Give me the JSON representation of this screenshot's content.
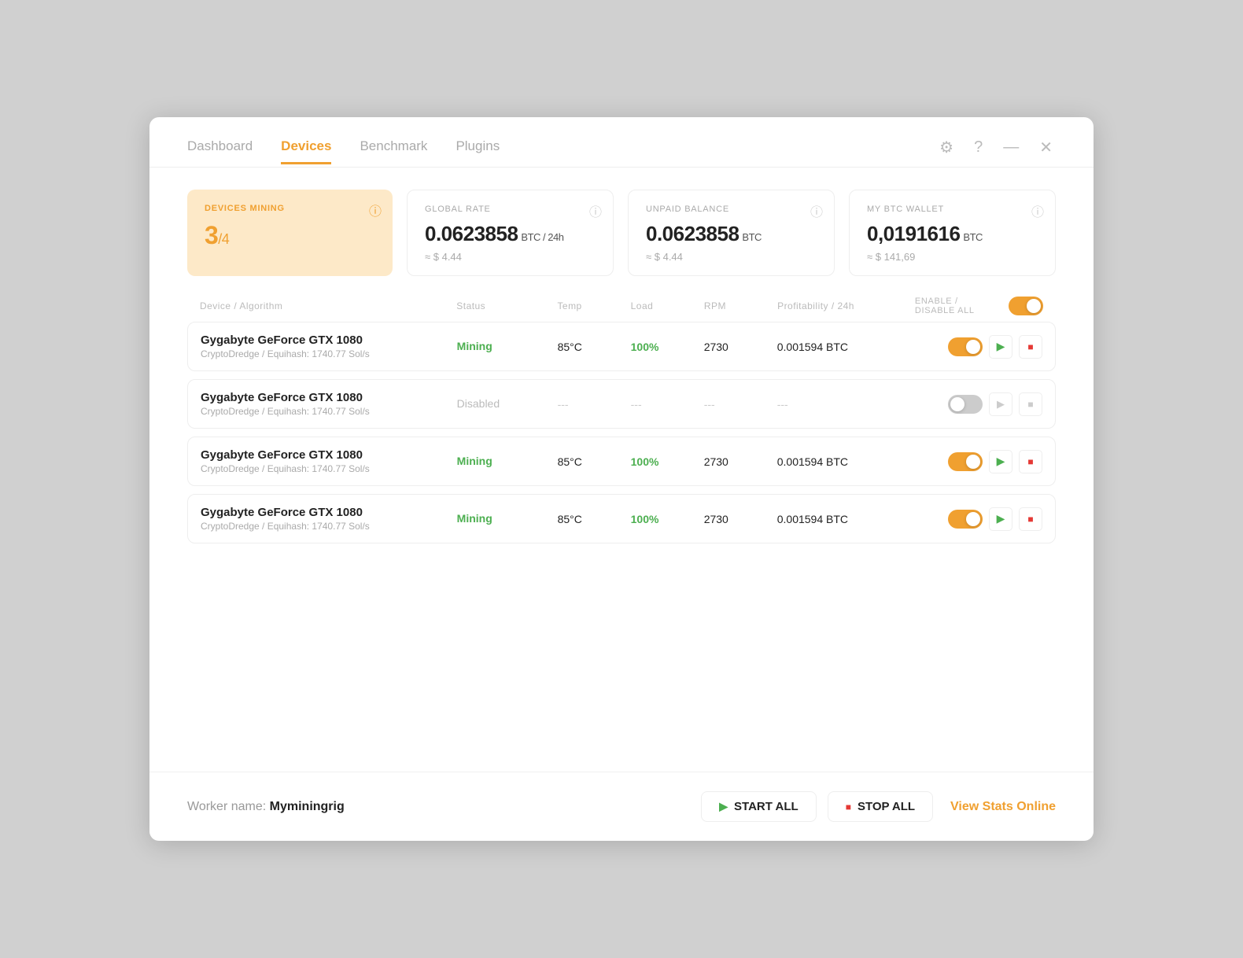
{
  "nav": {
    "items": [
      {
        "id": "dashboard",
        "label": "Dashboard",
        "active": false
      },
      {
        "id": "devices",
        "label": "Devices",
        "active": true
      },
      {
        "id": "benchmark",
        "label": "Benchmark",
        "active": false
      },
      {
        "id": "plugins",
        "label": "Plugins",
        "active": false
      }
    ]
  },
  "stats": {
    "devices_mining": {
      "label": "DEVICES MINING",
      "value": "3",
      "denom": "/4"
    },
    "global_rate": {
      "label": "GLOBAL RATE",
      "main": "0.0623858",
      "unit": "BTC / 24h",
      "sub": "≈ $ 4.44"
    },
    "unpaid_balance": {
      "label": "UNPAID BALANCE",
      "main": "0.0623858",
      "unit": "BTC",
      "sub": "≈ $ 4.44"
    },
    "btc_wallet": {
      "label": "MY BTC WALLET",
      "main": "0,0191616",
      "unit": "BTC",
      "sub": "≈ $ 141,69"
    }
  },
  "table": {
    "headers": {
      "device": "Device / Algorithm",
      "status": "Status",
      "temp": "Temp",
      "load": "Load",
      "rpm": "RPM",
      "profit": "Profitability / 24h",
      "enable_all": "ENABLE / DISABLE ALL"
    },
    "rows": [
      {
        "name": "Gygabyte GeForce GTX 1080",
        "algo": "CryptoDredge / Equihash: 1740.77 Sol/s",
        "status": "Mining",
        "status_type": "mining",
        "temp": "85°C",
        "load": "100%",
        "rpm": "2730",
        "profit": "0.001594 BTC",
        "enabled": true
      },
      {
        "name": "Gygabyte GeForce GTX 1080",
        "algo": "CryptoDredge / Equihash: 1740.77 Sol/s",
        "status": "Disabled",
        "status_type": "disabled",
        "temp": "---",
        "load": "---",
        "rpm": "---",
        "profit": "---",
        "enabled": false
      },
      {
        "name": "Gygabyte GeForce GTX 1080",
        "algo": "CryptoDredge / Equihash: 1740.77 Sol/s",
        "status": "Mining",
        "status_type": "mining",
        "temp": "85°C",
        "load": "100%",
        "rpm": "2730",
        "profit": "0.001594 BTC",
        "enabled": true
      },
      {
        "name": "Gygabyte GeForce GTX 1080",
        "algo": "CryptoDredge / Equihash: 1740.77 Sol/s",
        "status": "Mining",
        "status_type": "mining",
        "temp": "85°C",
        "load": "100%",
        "rpm": "2730",
        "profit": "0.001594 BTC",
        "enabled": true
      }
    ]
  },
  "footer": {
    "worker_prefix": "Worker name:",
    "worker_name": "Myminingrig",
    "start_all": "START ALL",
    "stop_all": "STOP ALL",
    "view_stats": "View Stats Online"
  }
}
